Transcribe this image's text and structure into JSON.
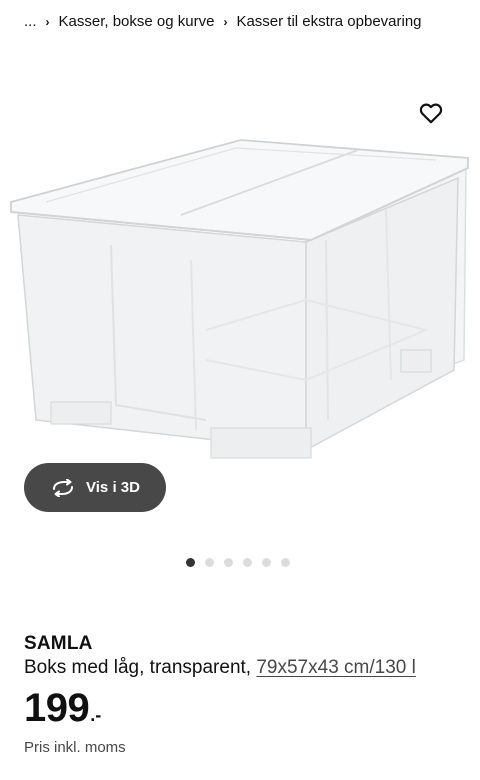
{
  "breadcrumb": {
    "ellipsis": "...",
    "items": [
      {
        "label": "Kasser, bokse og kurve"
      },
      {
        "label": "Kasser til ekstra opbevaring"
      }
    ]
  },
  "gallery": {
    "view3d_label": "Vis i 3D",
    "slides_total": 6,
    "active_slide": 1
  },
  "product": {
    "name": "SAMLA",
    "description": "Boks med låg, transparent,",
    "dimensions": "79x57x43 cm/130 l",
    "price_integer": "199",
    "price_suffix": ".-",
    "price_note": "Pris inkl. moms"
  },
  "colors": {
    "text": "#111111",
    "muted": "#484848",
    "button_bg": "#484848",
    "dot_active": "#333333",
    "dot_inactive": "#dcdcdc"
  }
}
